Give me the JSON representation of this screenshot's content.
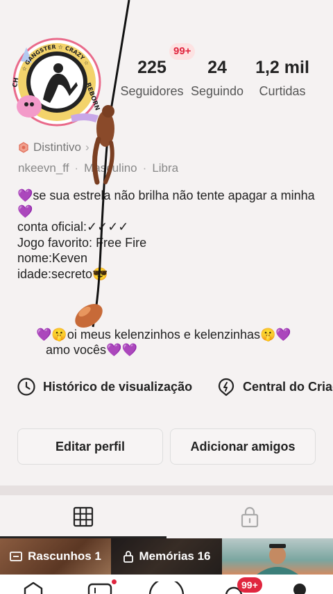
{
  "avatar": {
    "ring_text_top": "☆ GANGSTER ☆ CRAZY ☆",
    "ring_text_right": "REBORN",
    "ring_text_left": "CH"
  },
  "stats": {
    "followers_count": "225",
    "followers_label": "Seguidores",
    "following_count": "24",
    "following_label": "Seguindo",
    "likes_count": "1,2 mil",
    "likes_label": "Curtidas",
    "badge": "99+"
  },
  "profile": {
    "distintivo_label": "Distintivo",
    "username": "nkeevn_ff",
    "gender": "Masculino",
    "sign": "Libra"
  },
  "bio": {
    "line1": "💜se sua estrela não brilha não tente apagar a minha💜",
    "line2": "conta oficial:✓✓✓✓",
    "line3": "Jogo favorito: Free Fire",
    "line4": "nome:Keven",
    "line5": "idade:secreto😎",
    "greet1": "💜🤫oi meus kelenzinhos e kelenzinhas🤫💜",
    "greet2": "amo vocês💜💜"
  },
  "links": {
    "history": "Histórico de visualização",
    "central": "Central do Criad"
  },
  "buttons": {
    "edit": "Editar perfil",
    "add": "Adicionar amigos"
  },
  "tiles": {
    "drafts": "Rascunhos 1",
    "memories": "Memórias 16"
  },
  "nav": {
    "badge": "99+"
  },
  "colors": {
    "accent": "#e0263f",
    "background": "#f5f2f2"
  }
}
